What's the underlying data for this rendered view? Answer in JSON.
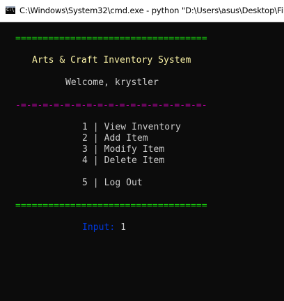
{
  "window": {
    "title": "C:\\Windows\\System32\\cmd.exe - python  \"D:\\Users\\asus\\Desktop\\Files\\",
    "icon": "cmd-icon",
    "icon_glyph": "C:\\"
  },
  "console": {
    "top_rule": "===================================",
    "app_title": "Arts & Craft Inventory System",
    "welcome": "Welcome, krystler",
    "mid_rule": "-=-=-=-=-=-=-=-=-=-=-=-=-=-=-=-=-=-",
    "menu": [
      {
        "num": "1",
        "sep": "|",
        "label": "View Inventory"
      },
      {
        "num": "2",
        "sep": "|",
        "label": "Add Item"
      },
      {
        "num": "3",
        "sep": "|",
        "label": "Modify Item"
      },
      {
        "num": "4",
        "sep": "|",
        "label": "Delete Item"
      },
      {
        "num": "5",
        "sep": "|",
        "label": "Log Out"
      }
    ],
    "bottom_rule": "===================================",
    "input_prompt": "Input:",
    "input_value": "1"
  },
  "colors": {
    "background": "#0c0c0c",
    "rule": "#16c60c",
    "title": "#f9f1a5",
    "text": "#cccccc",
    "divider": "#b4009e",
    "prompt": "#0037da"
  }
}
